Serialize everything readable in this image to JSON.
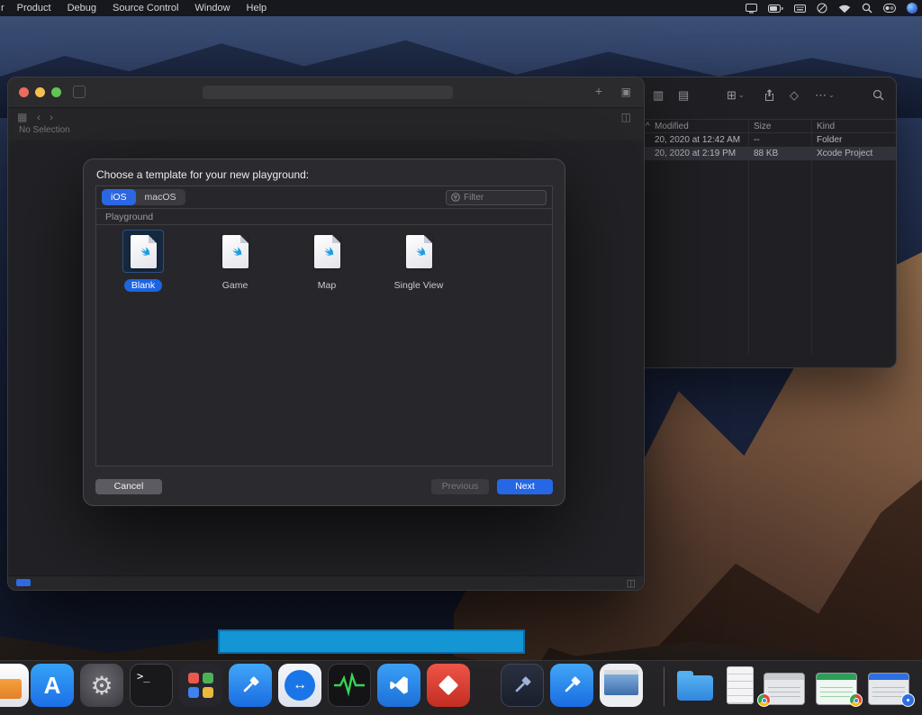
{
  "menu_bar": {
    "partial_item": "r",
    "items": [
      "Product",
      "Debug",
      "Source Control",
      "Window",
      "Help"
    ]
  },
  "xcode_window": {
    "status_text": "No Selection",
    "add_glyph": "+",
    "library_glyph": "▣",
    "navigator_glyph": "▦",
    "back_glyph": "‹",
    "forward_glyph": "›",
    "inspector_glyph": "◫",
    "debug_area_glyph": "◫"
  },
  "finder_window": {
    "toolbar_glyphs": {
      "list_view": "▥",
      "gallery_view": "▤",
      "group": "⊞",
      "tag": "◇",
      "more": "⋯",
      "chevron": "⌄"
    },
    "sort_glyph": "^",
    "columns": {
      "modified": "Modified",
      "size": "Size",
      "kind": "Kind"
    },
    "rows": [
      {
        "modified": "20, 2020 at 12:42 AM",
        "size": "--",
        "kind": "Folder"
      },
      {
        "modified": "20, 2020 at 2:19 PM",
        "size": "88 KB",
        "kind": "Xcode Project"
      }
    ]
  },
  "dialog": {
    "title": "Choose a template for your new playground:",
    "tabs": [
      {
        "label": "iOS"
      },
      {
        "label": "macOS"
      }
    ],
    "filter_placeholder": "Filter",
    "section_header": "Playground",
    "templates": [
      {
        "label": "Blank"
      },
      {
        "label": "Game"
      },
      {
        "label": "Map"
      },
      {
        "label": "Single View"
      }
    ],
    "buttons": {
      "cancel": "Cancel",
      "previous": "Previous",
      "next": "Next"
    }
  },
  "dock": {
    "terminal_glyph": ">_",
    "appstore_letter": "A",
    "prefs_glyph": "⚙",
    "teamviewer_glyph": "↔"
  },
  "colors": {
    "accent_blue": "#2667e6",
    "selection_blue": "#1d64e2",
    "drag_fill": "#1496d4",
    "drag_border": "#0e6ba2"
  }
}
